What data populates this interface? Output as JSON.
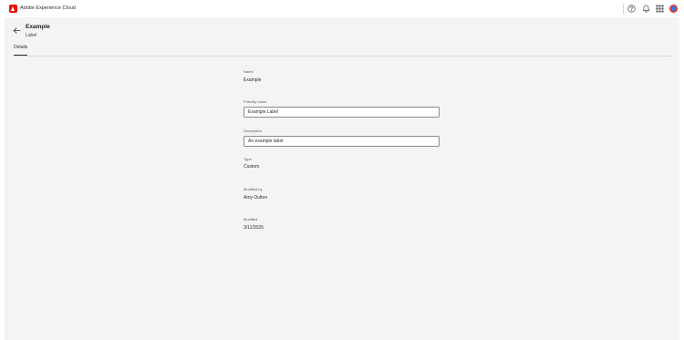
{
  "app": {
    "name": "Adobe Experience Cloud",
    "brand_color": "#eb1000"
  },
  "topbar": {
    "icons": [
      "help-icon",
      "bell-icon",
      "app-grid-icon",
      "avatar"
    ]
  },
  "header": {
    "title": "Example",
    "subtitle": "Label"
  },
  "tabs": [
    {
      "label": "Details",
      "selected": true
    }
  ],
  "fields": {
    "name": {
      "label": "Name",
      "value": "Example"
    },
    "friendly_name": {
      "label": "Friendly name",
      "value": "Example Label"
    },
    "description": {
      "label": "Description",
      "value": "An example label."
    },
    "type": {
      "label": "Type",
      "value": "Custom"
    },
    "modified_by": {
      "label": "Modified by",
      "value": "Amy Oulton"
    },
    "modified": {
      "label": "Modified",
      "value": "3/11/2025"
    }
  }
}
